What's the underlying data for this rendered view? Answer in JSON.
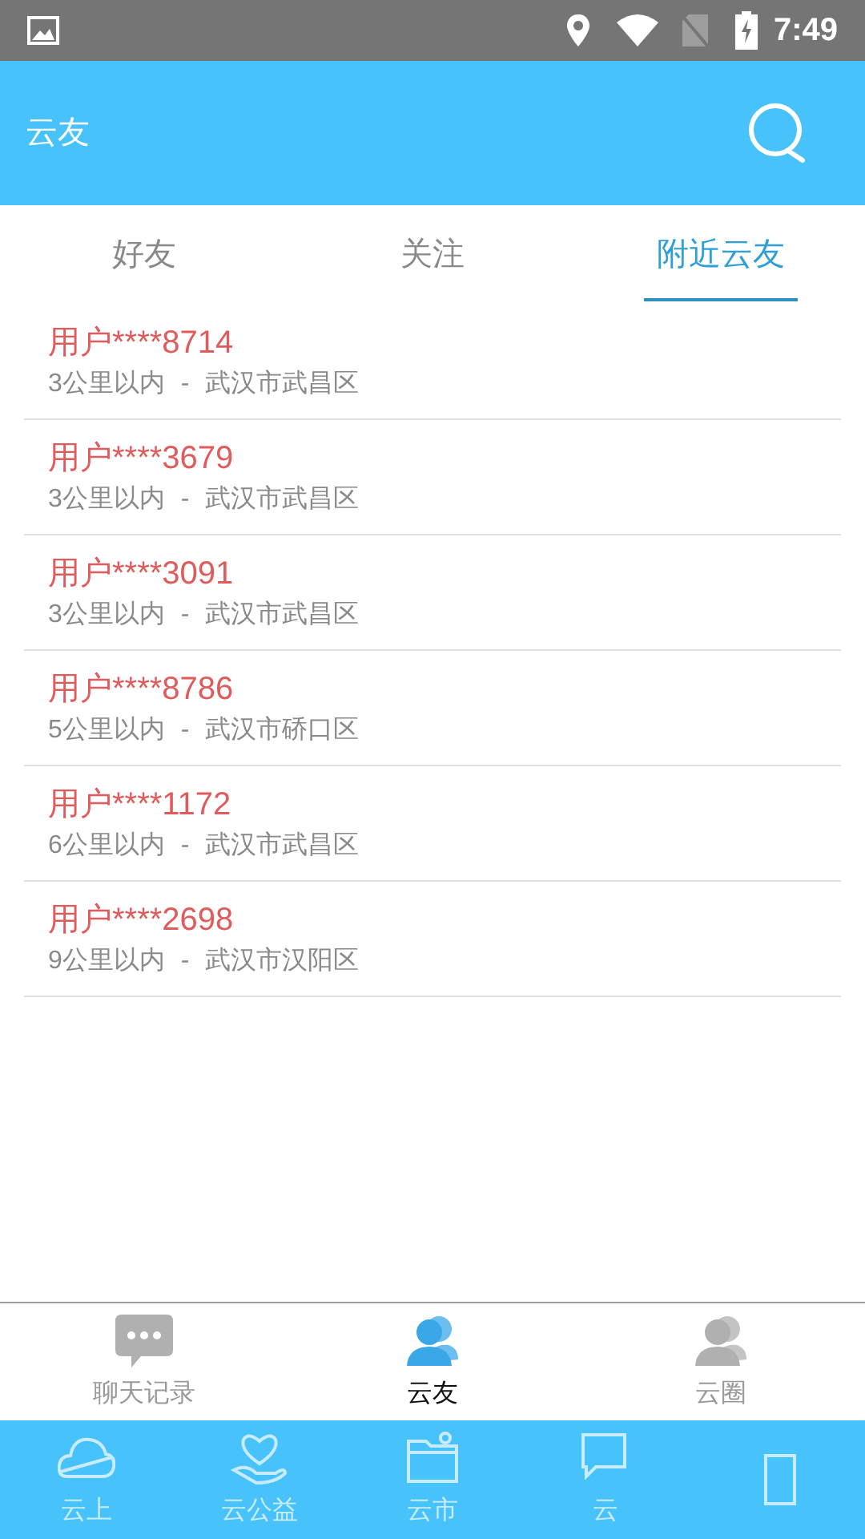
{
  "status_bar": {
    "time": "7:49"
  },
  "header": {
    "title": "云友"
  },
  "tabs": [
    {
      "label": "好友",
      "selected": false
    },
    {
      "label": "关注",
      "selected": false
    },
    {
      "label": "附近云友",
      "selected": true
    }
  ],
  "users": [
    {
      "name": "用户****8714",
      "distance": "3公里以内",
      "separator": "-",
      "area": "武汉市武昌区"
    },
    {
      "name": "用户****3679",
      "distance": "3公里以内",
      "separator": "-",
      "area": "武汉市武昌区"
    },
    {
      "name": "用户****3091",
      "distance": "3公里以内",
      "separator": "-",
      "area": "武汉市武昌区"
    },
    {
      "name": "用户****8786",
      "distance": "5公里以内",
      "separator": "-",
      "area": "武汉市硚口区"
    },
    {
      "name": "用户****1172",
      "distance": "6公里以内",
      "separator": "-",
      "area": "武汉市武昌区"
    },
    {
      "name": "用户****2698",
      "distance": "9公里以内",
      "separator": "-",
      "area": "武汉市汉阳区"
    }
  ],
  "sub_nav": [
    {
      "kind": "chat",
      "label": "聊天记录",
      "selected": false
    },
    {
      "kind": "friends",
      "label": "云友",
      "selected": true
    },
    {
      "kind": "circle",
      "label": "云圈",
      "selected": false
    }
  ],
  "main_nav": [
    {
      "kind": "cloud",
      "label": "云上"
    },
    {
      "kind": "charity",
      "label": "云公益"
    },
    {
      "kind": "market",
      "label": "云市"
    },
    {
      "kind": "messages",
      "label": "云"
    },
    {
      "kind": "other"
    }
  ]
}
